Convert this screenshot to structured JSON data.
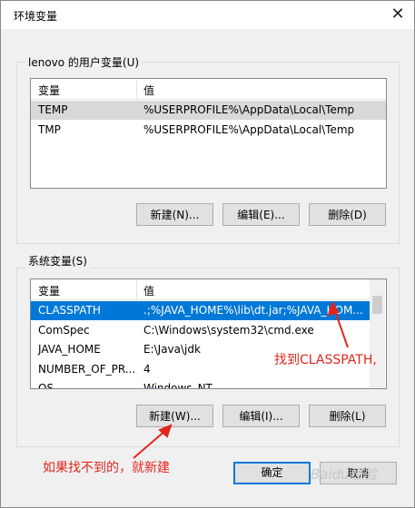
{
  "window": {
    "title": "环境变量",
    "close_glyph": "✕"
  },
  "user_vars": {
    "group_label": "lenovo 的用户变量(U)",
    "columns": [
      "变量",
      "值"
    ],
    "rows": [
      {
        "name": "TEMP",
        "value": "%USERPROFILE%\\AppData\\Local\\Temp"
      },
      {
        "name": "TMP",
        "value": "%USERPROFILE%\\AppData\\Local\\Temp"
      }
    ],
    "buttons": {
      "new": "新建(N)...",
      "edit": "编辑(E)...",
      "delete": "删除(D)"
    }
  },
  "system_vars": {
    "group_label": "系统变量(S)",
    "columns": [
      "变量",
      "值"
    ],
    "rows": [
      {
        "name": "CLASSPATH",
        "value": ".;%JAVA_HOME%\\lib\\dt.jar;%JAVA_HOM..."
      },
      {
        "name": "ComSpec",
        "value": "C:\\Windows\\system32\\cmd.exe"
      },
      {
        "name": "JAVA_HOME",
        "value": "E:\\Java\\jdk"
      },
      {
        "name": "NUMBER_OF_PR...",
        "value": "4"
      },
      {
        "name": "OS",
        "value": "Windows_NT"
      }
    ],
    "buttons": {
      "new": "新建(W)...",
      "edit": "编辑(I)...",
      "delete": "删除(L)"
    }
  },
  "footer": {
    "ok": "确定",
    "cancel": "取消"
  },
  "annotations": {
    "find_classpath": "找到CLASSPATH,",
    "create_if_missing": "如果找不到的，就新建"
  },
  "watermark": "Baidu经验",
  "colors": {
    "selection": "#0078d7",
    "annotation": "#e2261c"
  }
}
